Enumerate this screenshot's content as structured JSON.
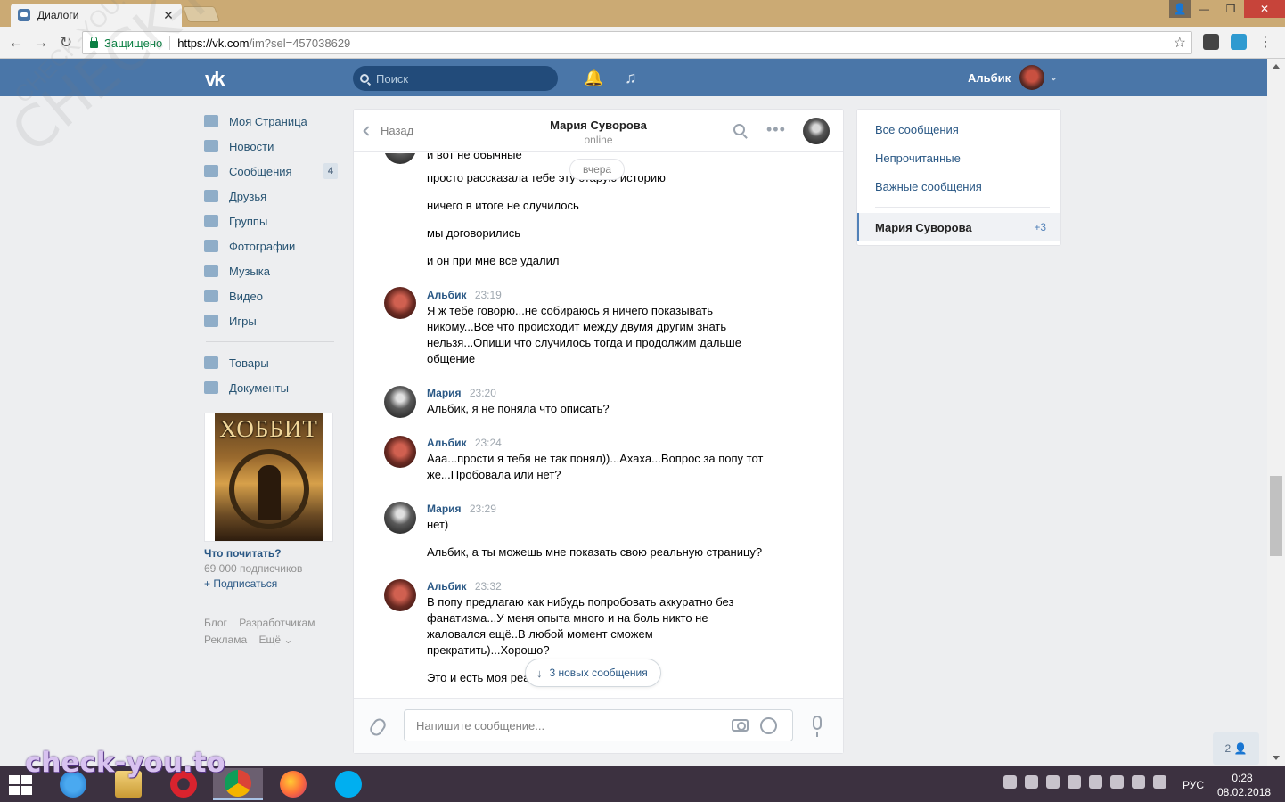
{
  "browser": {
    "tab_title": "Диалоги",
    "tab_close": "✕",
    "secure_label": "Защищено",
    "url_host": "https://vk.com",
    "url_rest": "/im?sel=457038629",
    "window_buttons": {
      "user": "👤",
      "minimize": "—",
      "restore": "❐",
      "close": "✕"
    }
  },
  "vk": {
    "logo": "vk",
    "search_placeholder": "Поиск",
    "user_name": "Альбик",
    "caret": "⌄"
  },
  "left_nav": {
    "items": [
      {
        "label": "Моя Страница",
        "icon": "home-icon"
      },
      {
        "label": "Новости",
        "icon": "news-icon"
      },
      {
        "label": "Сообщения",
        "icon": "messages-icon",
        "count": "4"
      },
      {
        "label": "Друзья",
        "icon": "friends-icon"
      },
      {
        "label": "Группы",
        "icon": "groups-icon"
      },
      {
        "label": "Фотографии",
        "icon": "camera-icon"
      },
      {
        "label": "Музыка",
        "icon": "music-icon"
      },
      {
        "label": "Видео",
        "icon": "video-icon"
      },
      {
        "label": "Игры",
        "icon": "games-icon"
      }
    ],
    "secondary": [
      {
        "label": "Товары",
        "icon": "market-icon"
      },
      {
        "label": "Документы",
        "icon": "docs-icon"
      }
    ],
    "promo": {
      "poster_title": "ХОББИТ",
      "title": "Что почитать?",
      "subscribers": "69 000 подписчиков",
      "join": "+ Подписаться"
    },
    "footer": {
      "blog": "Блог",
      "dev": "Разработчикам",
      "ads": "Реклама",
      "more": "Ещё ⌄"
    }
  },
  "chat": {
    "back_label": "Назад",
    "peer_name": "Мария Суворова",
    "peer_status": "online",
    "more": "•••",
    "date_pill": "вчера",
    "cut_text": "и вот не обычные",
    "messages": [
      {
        "text": "просто рассказала тебе эту старую историю"
      },
      {
        "text": "ничего в итоге не случилось"
      },
      {
        "text": "мы договорились"
      },
      {
        "text": "и он при мне все удалил"
      },
      {
        "author": "Альбик",
        "time": "23:19",
        "lines": [
          "Я ж тебе говорю...не собираюсь я ничего показывать",
          "никому...Всё что происходит между двумя другим знать",
          "нельзя...Опиши что случилось тогда и продолжим дальше",
          "общение"
        ]
      },
      {
        "author": "Мария",
        "time": "23:20",
        "lines": [
          "Альбик, я не поняла что описать?"
        ]
      },
      {
        "author": "Альбик",
        "time": "23:24",
        "lines": [
          "Ааа...прости я тебя не так понял))...Ахаха...Вопрос за попу тот",
          "же...Пробовала или нет?"
        ]
      },
      {
        "author": "Мария",
        "time": "23:29",
        "lines": [
          "нет)"
        ]
      },
      {
        "text": "Альбик, а ты можешь мне показать свою реальную страницу?"
      },
      {
        "author": "Альбик",
        "time": "23:32",
        "lines": [
          "В попу предлагаю как нибудь попробовать аккуратно без",
          "фанатизма...У меня опыта много и на боль никто не",
          "жаловался ещё..В любой момент сможем",
          "прекратить)...Хорошо?"
        ]
      },
      {
        "text": "Это и есть моя реа"
      }
    ],
    "new_messages": "3 новых сообщения",
    "new_arrow": "↓",
    "composer_placeholder": "Напишите сообщение..."
  },
  "filters": {
    "all": "Все сообщения",
    "unread": "Непрочитанные",
    "important": "Важные сообщения",
    "active_name": "Мария Суворова",
    "active_count": "+3"
  },
  "online_friends": "2 👤",
  "watermarks": {
    "diagonal": "CHECK-YOU.ME",
    "small": "CHECK-YOU.ME",
    "bottom": "check-you.to"
  },
  "taskbar": {
    "lang": "РУС",
    "time": "0:28",
    "date": "08.02.2018"
  },
  "colors": {
    "vk_blue": "#4a76a8",
    "link": "#2a5885",
    "titlebar": "#cbaa74",
    "taskbar": "#3c3140"
  }
}
